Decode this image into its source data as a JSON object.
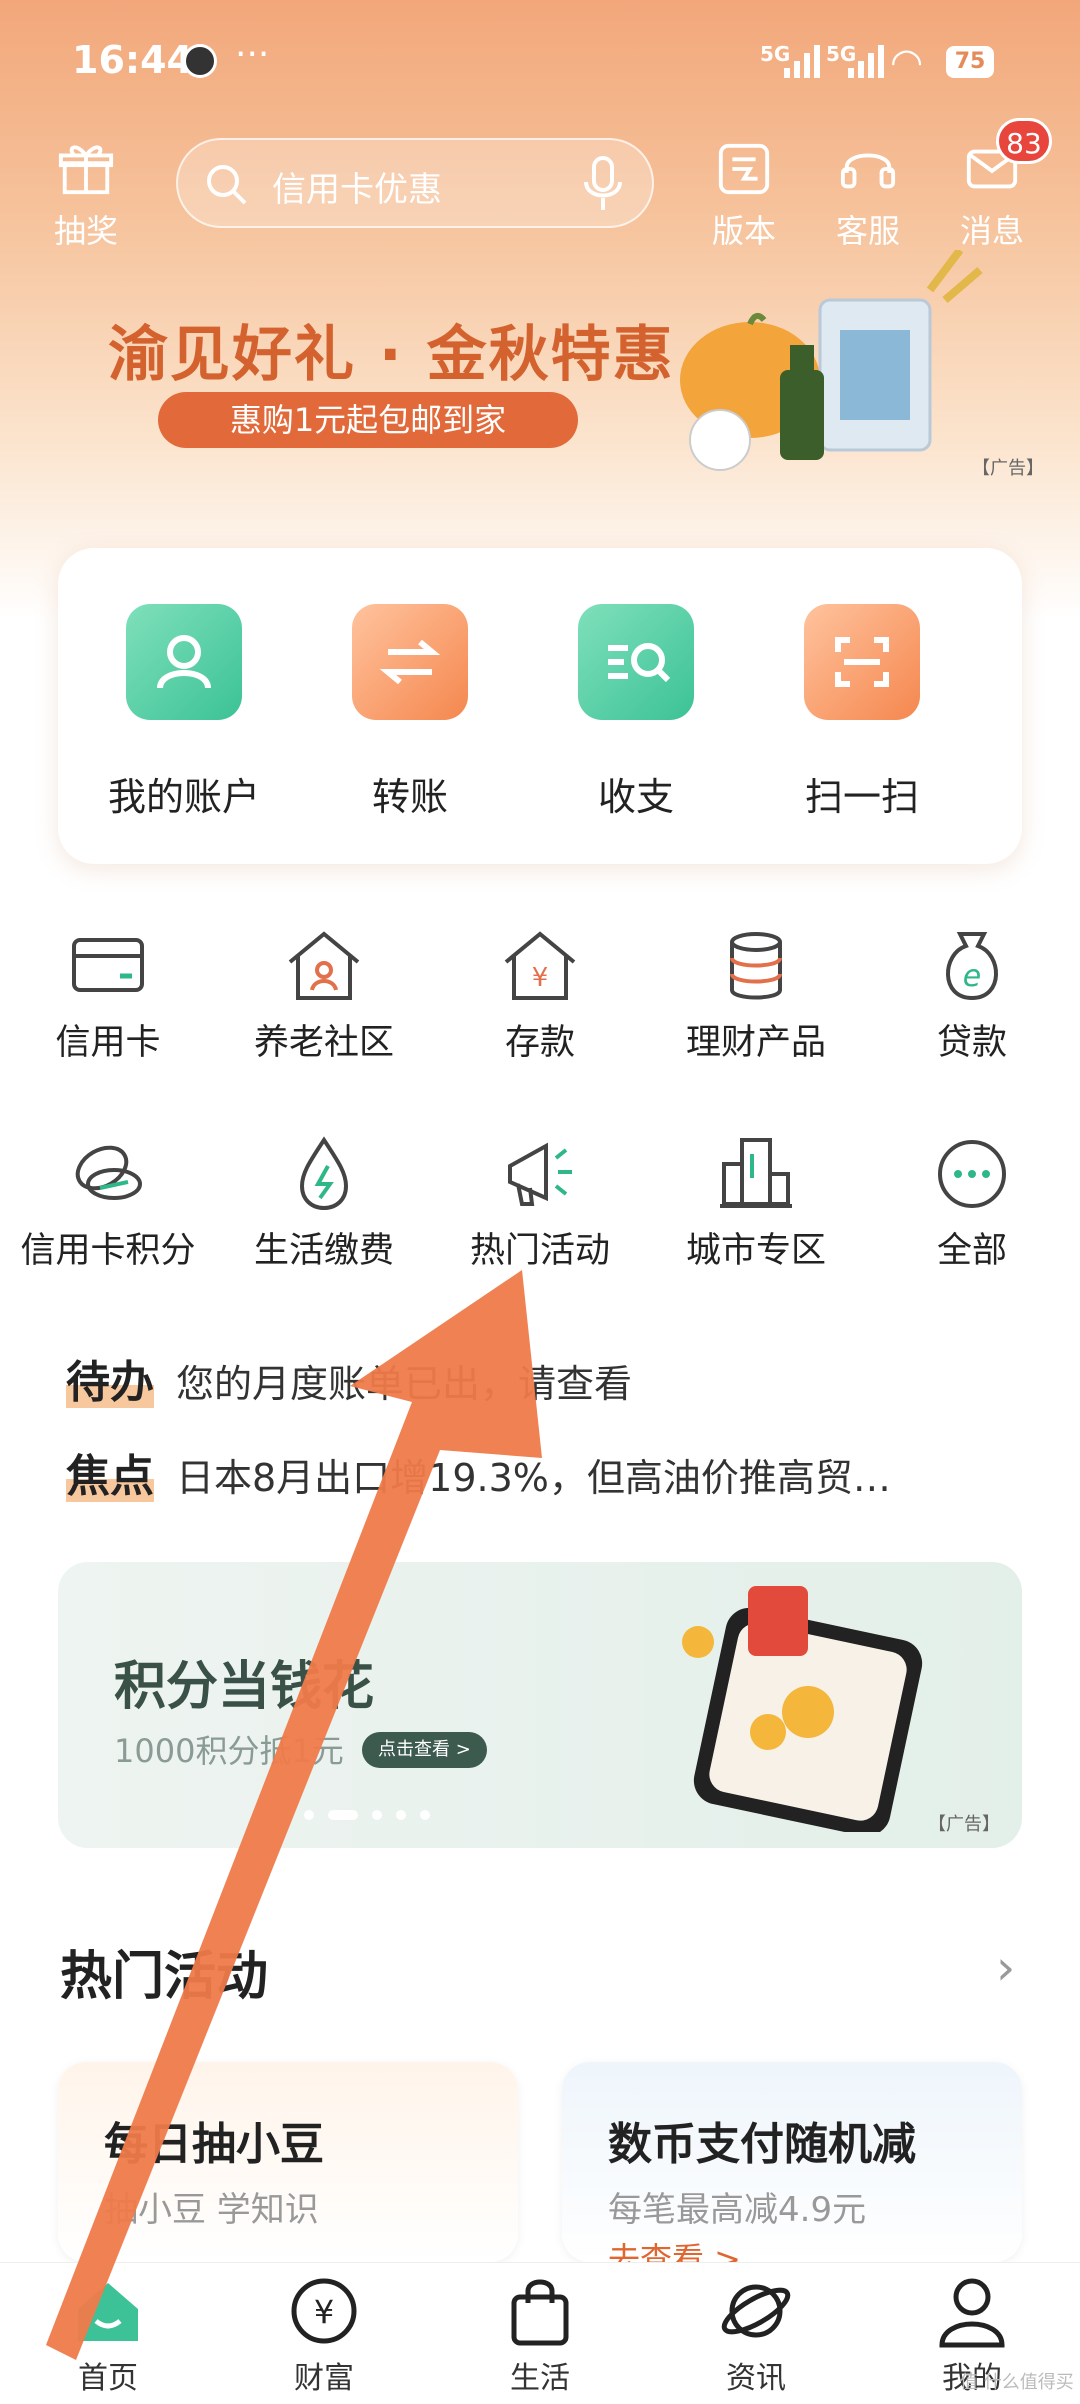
{
  "status_bar": {
    "time": "16:44",
    "more": "···",
    "net1": "5G",
    "net2": "5G",
    "battery": "75"
  },
  "top_bar": {
    "lottery_label": "抽奖",
    "search_placeholder": "信用卡优惠",
    "version_label": "版本",
    "service_label": "客服",
    "messages_label": "消息",
    "messages_badge": "83"
  },
  "banner": {
    "title": "渝见好礼 · 金秋特惠",
    "subtitle": "惠购1元起包邮到家",
    "ad_tag": "【广告】"
  },
  "quick_actions": [
    {
      "label": "我的账户",
      "icon": "account-icon",
      "color": "green"
    },
    {
      "label": "转账",
      "icon": "transfer-icon",
      "color": "orange"
    },
    {
      "label": "收支",
      "icon": "income-expense-icon",
      "color": "green"
    },
    {
      "label": "扫一扫",
      "icon": "scan-icon",
      "color": "orange"
    }
  ],
  "grid": [
    {
      "label": "信用卡",
      "icon": "credit-card-icon"
    },
    {
      "label": "养老社区",
      "icon": "elder-community-icon"
    },
    {
      "label": "存款",
      "icon": "deposit-icon"
    },
    {
      "label": "理财产品",
      "icon": "wealth-product-icon"
    },
    {
      "label": "贷款",
      "icon": "loan-icon"
    },
    {
      "label": "信用卡积分",
      "icon": "card-points-icon"
    },
    {
      "label": "生活缴费",
      "icon": "utility-payment-icon"
    },
    {
      "label": "热门活动",
      "icon": "megaphone-icon"
    },
    {
      "label": "城市专区",
      "icon": "city-icon"
    },
    {
      "label": "全部",
      "icon": "more-icon"
    }
  ],
  "notices": {
    "todo_tag": "待办",
    "todo_text": "您的月度账单已出，请查看",
    "focus_tag": "焦点",
    "focus_text": "日本8月出口增19.3%，但高油价推高贸…"
  },
  "promo": {
    "title": "积分当钱花",
    "subtitle": "1000积分抵1元",
    "button": "点击查看 >",
    "ad_tag": "【广告】"
  },
  "hot": {
    "title": "热门活动",
    "cards": [
      {
        "title": "每日抽小豆",
        "subtitle": "抽小豆 学知识",
        "link": ""
      },
      {
        "title": "数币支付随机减",
        "subtitle": "每笔最高减4.9元",
        "link": "去查看 >"
      }
    ]
  },
  "tabs": [
    {
      "label": "首页",
      "icon": "home-icon",
      "active": true
    },
    {
      "label": "财富",
      "icon": "wealth-icon"
    },
    {
      "label": "生活",
      "icon": "shopping-bag-icon"
    },
    {
      "label": "资讯",
      "icon": "planet-icon"
    },
    {
      "label": "我的",
      "icon": "profile-icon"
    }
  ],
  "watermark": "值 什么值得买",
  "colors": {
    "accent_orange": "#e26a3a",
    "accent_green": "#3cc296",
    "arrow": "#ef7a4a",
    "badge": "#e8453c"
  }
}
